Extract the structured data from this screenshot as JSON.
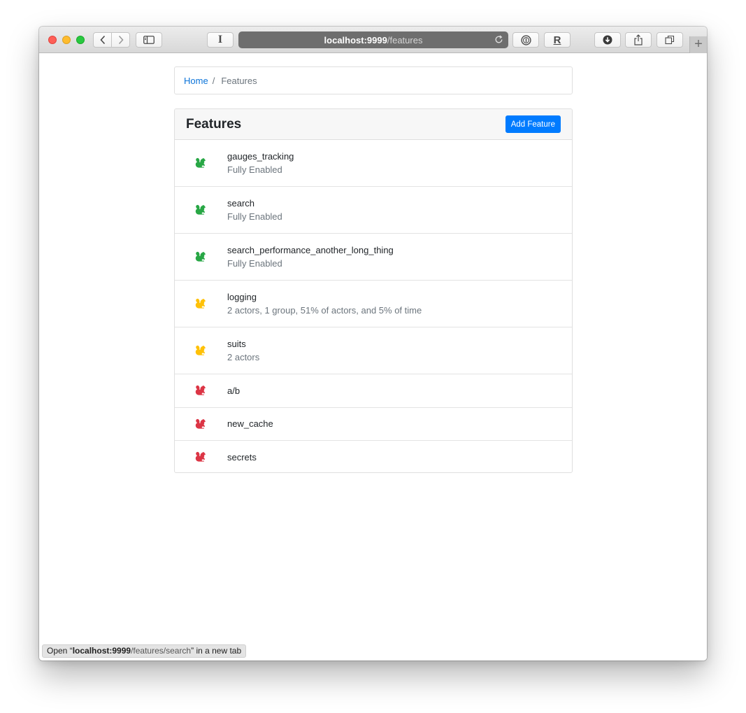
{
  "browser": {
    "address_host": "localhost:9999",
    "address_path": "/features",
    "reader_label": "I",
    "extension_label": "R",
    "new_tab_label": "+"
  },
  "breadcrumb": {
    "home": "Home",
    "separator": "/",
    "current": "Features"
  },
  "card": {
    "title": "Features",
    "add_label": "Add Feature"
  },
  "status_colors": {
    "on": "#28a745",
    "conditional": "#ffc107",
    "off": "#dc3545"
  },
  "features": [
    {
      "name": "gauges_tracking",
      "description": "Fully Enabled",
      "state": "on"
    },
    {
      "name": "search",
      "description": "Fully Enabled",
      "state": "on"
    },
    {
      "name": "search_performance_another_long_thing",
      "description": "Fully Enabled",
      "state": "on"
    },
    {
      "name": "logging",
      "description": "2 actors, 1 group, 51% of actors, and 5% of time",
      "state": "conditional"
    },
    {
      "name": "suits",
      "description": "2 actors",
      "state": "conditional"
    },
    {
      "name": "a/b",
      "description": "",
      "state": "off"
    },
    {
      "name": "new_cache",
      "description": "",
      "state": "off"
    },
    {
      "name": "secrets",
      "description": "",
      "state": "off"
    }
  ],
  "status_bar": {
    "prefix": "Open “",
    "host": "localhost:9999",
    "path": "/features/search",
    "suffix": "” in a new tab"
  }
}
